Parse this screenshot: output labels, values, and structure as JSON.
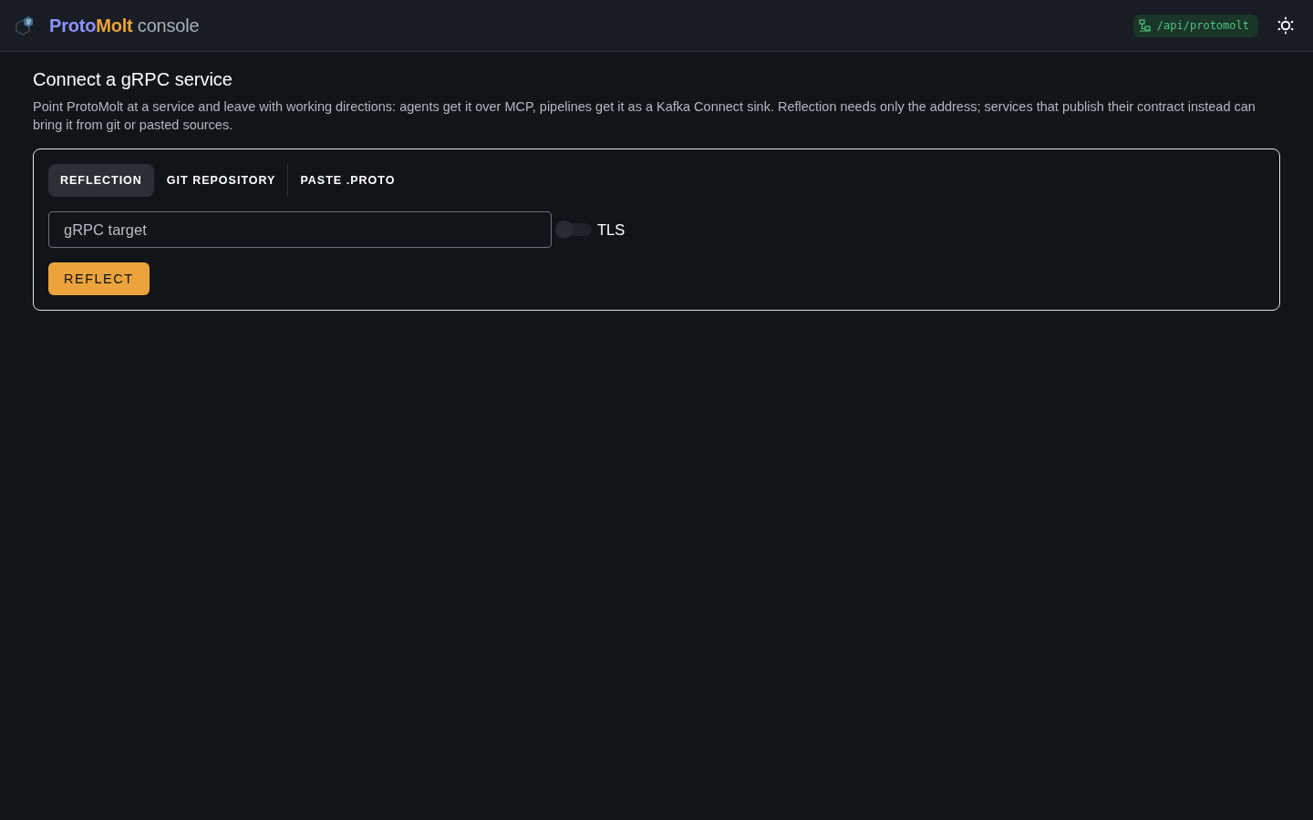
{
  "header": {
    "brand": {
      "name_parts": [
        "Proto",
        "Molt"
      ],
      "suffix": "console"
    },
    "endpoint": "/api/protomolt"
  },
  "intro": {
    "title": "Connect a gRPC service",
    "description": "Point ProtoMolt at a service and leave with working directions: agents get it over MCP, pipelines get it as a Kafka Connect sink. Reflection needs only the address; services that publish their contract instead can bring it from git or pasted sources."
  },
  "source_tabs": [
    {
      "label": "REFLECTION",
      "selected": true
    },
    {
      "label": "GIT REPOSITORY",
      "selected": false
    },
    {
      "label": "PASTE .PROTO",
      "selected": false
    }
  ],
  "target_field": {
    "placeholder": "gRPC target"
  },
  "tls": {
    "label": "TLS",
    "on": false
  },
  "action": {
    "label": "REFLECT"
  }
}
